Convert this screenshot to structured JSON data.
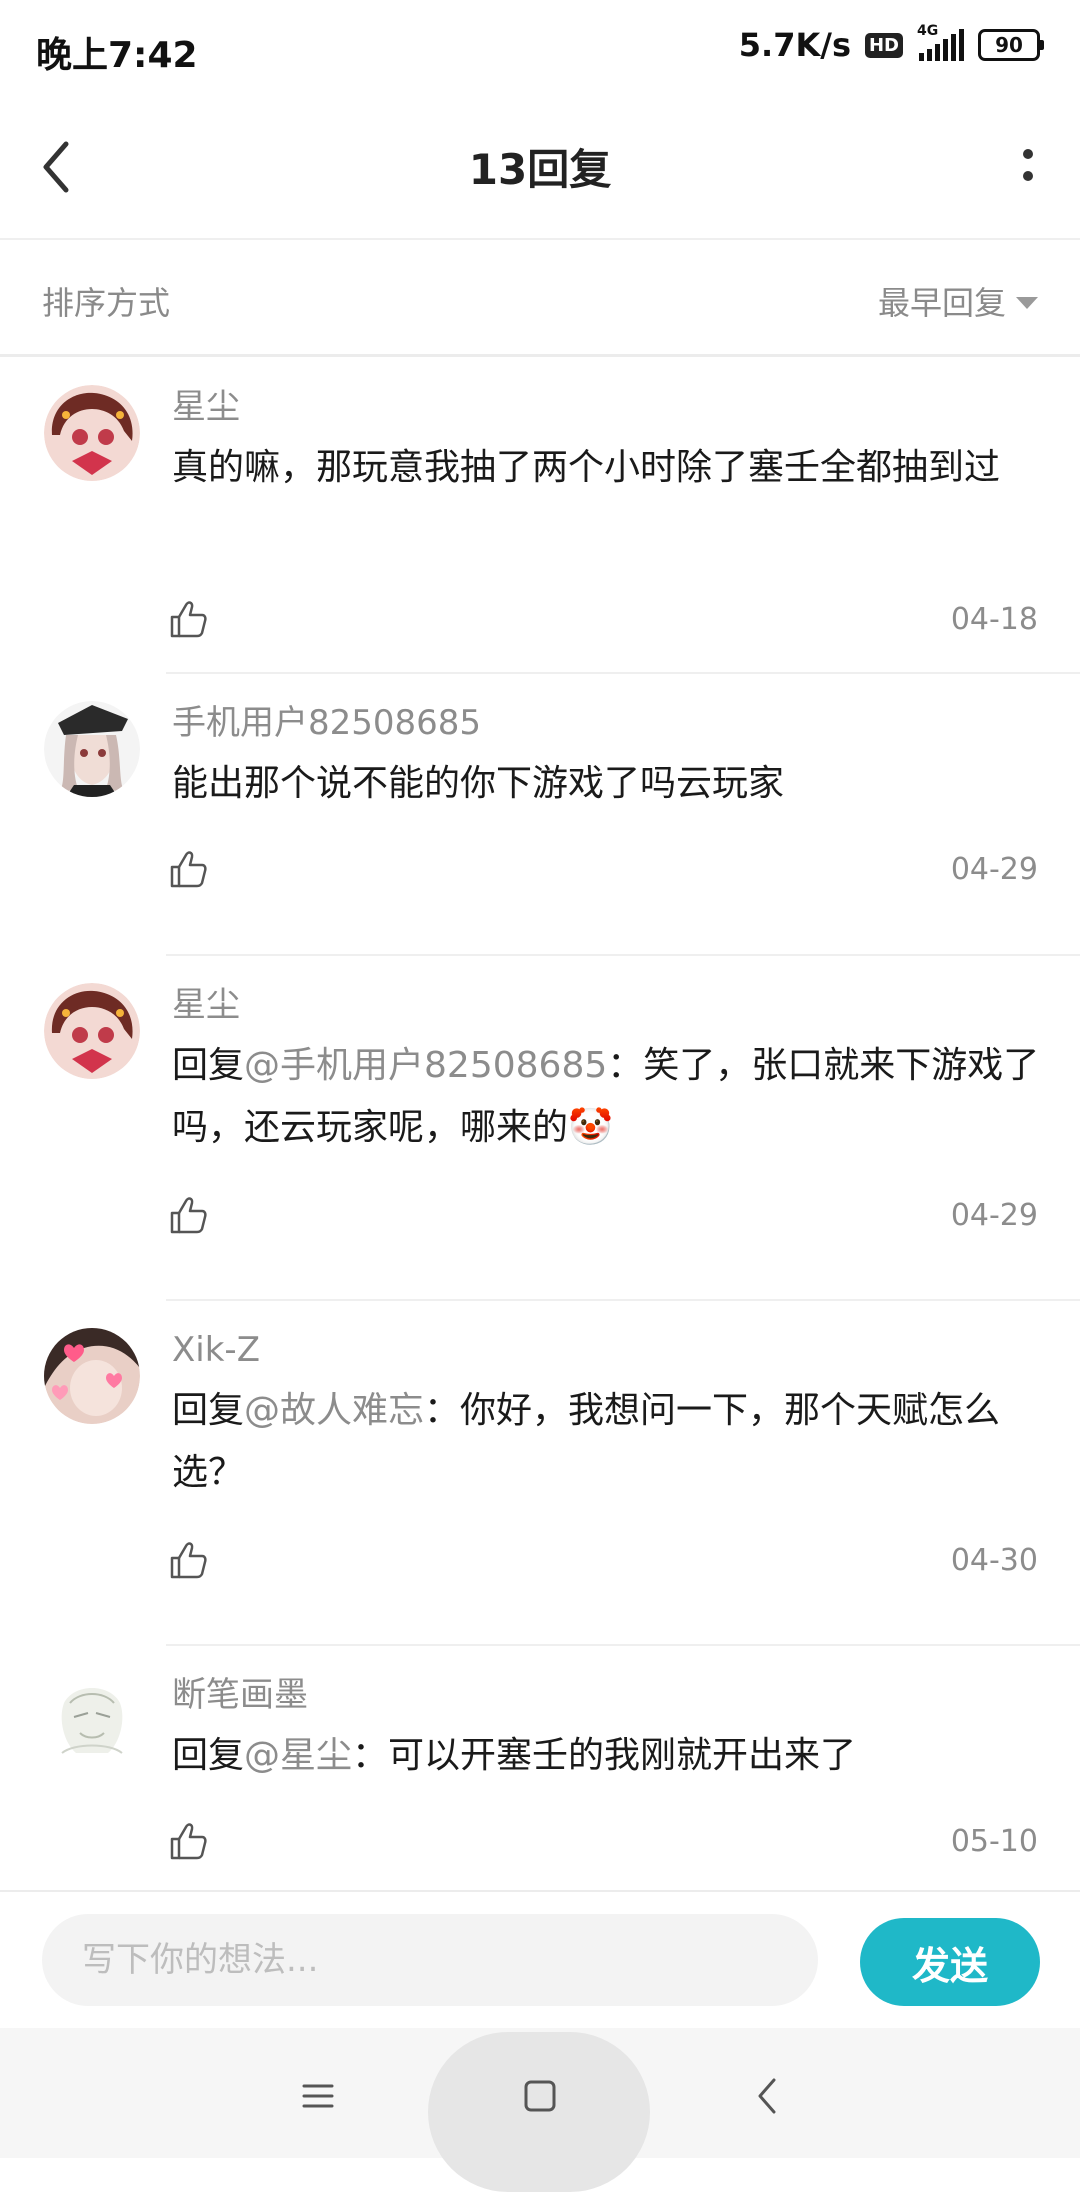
{
  "status_bar": {
    "time": "晚上7:42",
    "net_speed": "5.7K/s",
    "hd": "HD",
    "network": "4G",
    "battery": "90"
  },
  "header": {
    "title": "13回复"
  },
  "sort": {
    "label": "排序方式",
    "selected": "最早回复"
  },
  "replies": [
    {
      "username": "星尘",
      "prefix": "",
      "mention": "",
      "text": "真的嘛，那玩意我抽了两个小时除了塞壬全都抽到过",
      "date": "04-18",
      "emoji": ""
    },
    {
      "username": "手机用户82508685",
      "prefix": "",
      "mention": "",
      "text": "能出那个说不能的你下游戏了吗云玩家",
      "date": "04-29",
      "emoji": ""
    },
    {
      "username": "星尘",
      "prefix": "回复",
      "mention": "@手机用户82508685",
      "text": "：笑了，张口就来下游戏了吗，还云玩家呢，哪来的",
      "date": "04-29",
      "emoji": "🤡"
    },
    {
      "username": "Xik-Z",
      "prefix": "回复",
      "mention": "@故人难忘",
      "text": "：你好，我想问一下，那个天赋怎么选？",
      "date": "04-30",
      "emoji": ""
    },
    {
      "username": "断笔画墨",
      "prefix": "回复",
      "mention": "@星尘",
      "text": "：可以开塞壬的我刚就开出来了",
      "date": "05-10",
      "emoji": ""
    }
  ],
  "composer": {
    "placeholder": "写下你的想法...",
    "send_label": "发送"
  },
  "colors": {
    "accent": "#1fb8c8",
    "secondary_text": "#8c8c8c"
  }
}
